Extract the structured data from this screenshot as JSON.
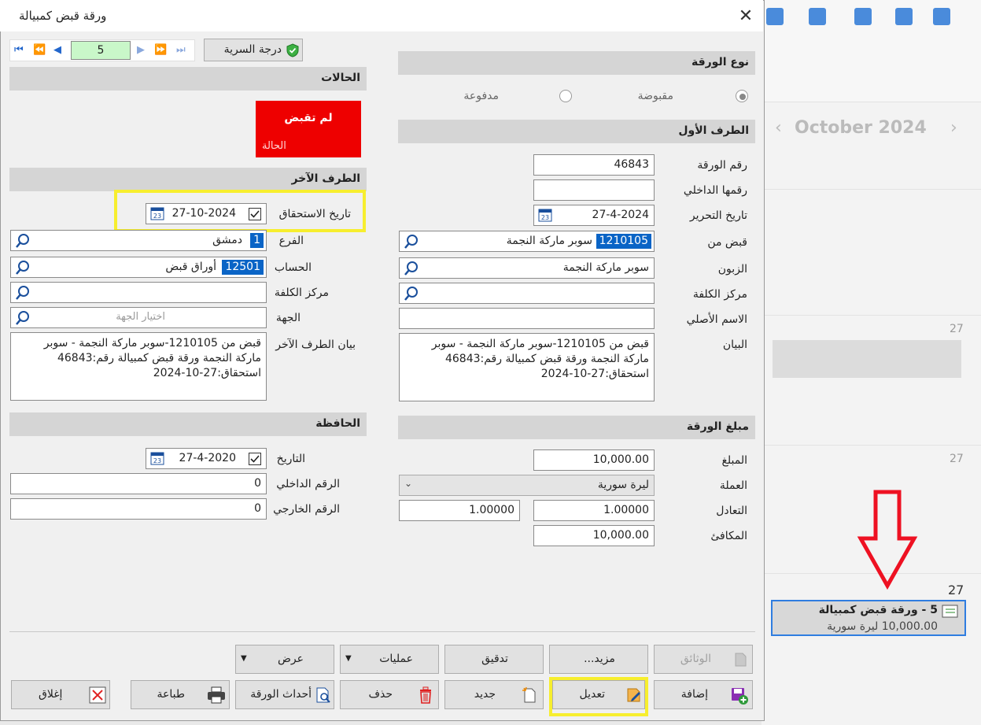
{
  "background_app": {
    "month_title": "October 2024",
    "day_numbers": [
      "27",
      "27",
      "27"
    ],
    "event": {
      "title": "5 - ورقة قبض كمبيالة",
      "subtitle": "10,000.00 ليرة سورية"
    }
  },
  "dialog": {
    "title": "ورقة قبض كمبيالة",
    "close_glyph": "✕",
    "navigator": {
      "current": "5"
    },
    "security_button": "درجة السرية",
    "sections": {
      "doc_type": "نوع الورقة",
      "first_party": "الطرف الأول",
      "amount": "مبلغ الورقة",
      "statuses": "الحالات",
      "other_party": "الطرف الآخر",
      "portfolio": "الحافظة"
    },
    "doc_type": {
      "received": "مقبوضة",
      "paid": "مدفوعة"
    },
    "status_box": {
      "title": "لم تقبض",
      "label": "الحالة",
      "color": "#ee0000"
    },
    "first_party": {
      "doc_number_label": "رقم الورقة",
      "doc_number": "46843",
      "internal_no_label": "رقمها الداخلي",
      "internal_no": "",
      "issue_date_label": "تاريخ التحرير",
      "issue_date": "27-4-2024",
      "received_from_label": "قبض من",
      "received_from_code": "1210105",
      "received_from_name": "سوبر ماركة النجمة",
      "customer_label": "الزبون",
      "customer": "سوبر ماركة النجمة",
      "cost_center_label": "مركز الكلفة",
      "cost_center": "",
      "original_name_label": "الاسم الأصلي",
      "original_name": "",
      "statement_label": "البيان",
      "statement": "قبض من 1210105-سوبر ماركة النجمة - سوبر ماركة النجمة ورقة قبض كمبيالة رقم:46843 استحقاق:27-10-2024"
    },
    "amount": {
      "amount_label": "المبلغ",
      "amount": "10,000.00",
      "currency_label": "العملة",
      "currency": "ليرة سورية",
      "rate_label": "التعادل",
      "rate": "1.00000",
      "rate2": "1.00000",
      "equivalent_label": "المكافئ",
      "equivalent": "10,000.00"
    },
    "other_party": {
      "due_date_label": "تاريخ الاستحقاق",
      "due_date": "27-10-2024",
      "branch_label": "الفرع",
      "branch_code": "1",
      "branch_name": "دمشق",
      "account_label": "الحساب",
      "account_code": "12501",
      "account_name": "أوراق قبض",
      "cost_center_label": "مركز الكلفة",
      "cost_center": "",
      "entity_label": "الجهة",
      "entity_placeholder": "اختيار الجهة",
      "statement_label": "بيان الطرف الآخر",
      "statement": "قبض من 1210105-سوبر ماركة النجمة - سوبر ماركة النجمة ورقة قبض كمبيالة رقم:46843 استحقاق:27-10-2024"
    },
    "portfolio": {
      "date_label": "التاريخ",
      "date": "27-4-2020",
      "internal_no_label": "الرقم الداخلي",
      "internal_no": "0",
      "external_no_label": "الرقم الخارجي",
      "external_no": "0"
    },
    "buttons": {
      "documents": "الوثائق",
      "more": "مزيد...",
      "audit": "تدقيق",
      "operations": "عمليات",
      "view": "عرض",
      "add": "إضافة",
      "edit": "تعديل",
      "new": "جديد",
      "delete": "حذف",
      "doc_events": "أحداث الورقة",
      "print": "طباعة",
      "close": "إغلاق"
    }
  }
}
